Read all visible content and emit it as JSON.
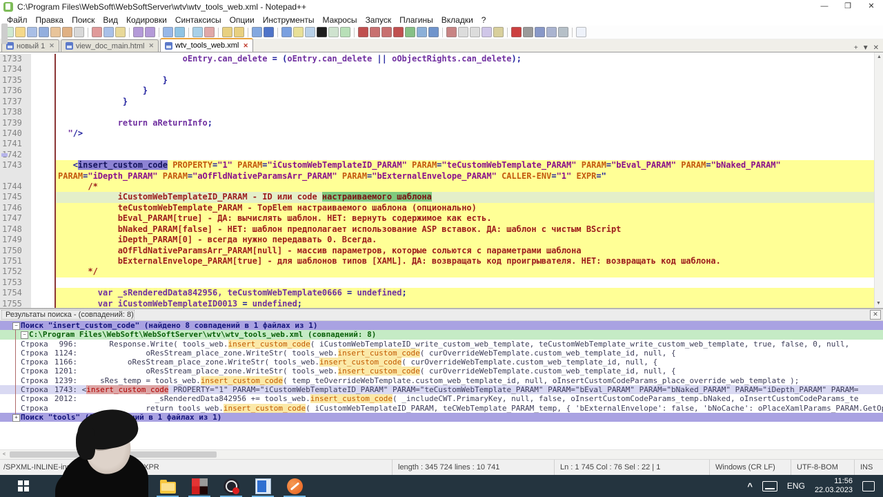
{
  "window": {
    "title": "C:\\Program Files\\WebSoft\\WebSoftServer\\wtv\\wtv_tools_web.xml - Notepad++",
    "controls": {
      "minimize": "—",
      "restore": "❐",
      "close": "✕"
    }
  },
  "menu": {
    "items": [
      "Файл",
      "Правка",
      "Поиск",
      "Вид",
      "Кодировки",
      "Синтаксисы",
      "Опции",
      "Инструменты",
      "Макросы",
      "Запуск",
      "Плагины",
      "Вкладки",
      "?"
    ]
  },
  "toolbar": {
    "icons": [
      {
        "n": "new-file",
        "c": "#cfe8cf"
      },
      {
        "n": "open-file",
        "c": "#f4d88a"
      },
      {
        "n": "save",
        "c": "#a9bfe6"
      },
      {
        "n": "save-all",
        "c": "#93aede"
      },
      {
        "n": "close",
        "c": "#e8c49a"
      },
      {
        "n": "close-all",
        "c": "#e0b184"
      },
      {
        "n": "print",
        "c": "#d8d8d8"
      },
      {
        "n": "sep"
      },
      {
        "n": "cut",
        "c": "#e09a9a"
      },
      {
        "n": "copy",
        "c": "#a8c0e8"
      },
      {
        "n": "paste",
        "c": "#e8d898"
      },
      {
        "n": "sep"
      },
      {
        "n": "undo",
        "c": "#b49ad8"
      },
      {
        "n": "redo",
        "c": "#b49ad8"
      },
      {
        "n": "sep"
      },
      {
        "n": "find",
        "c": "#98b8e8"
      },
      {
        "n": "replace",
        "c": "#8fc4e4"
      },
      {
        "n": "sep"
      },
      {
        "n": "zoom-in",
        "c": "#a8d0e8"
      },
      {
        "n": "zoom-out",
        "c": "#e0a8a8"
      },
      {
        "n": "sep"
      },
      {
        "n": "sync-vertical",
        "c": "#e8d080"
      },
      {
        "n": "sync-horizontal",
        "c": "#e8d080"
      },
      {
        "n": "sep"
      },
      {
        "n": "word-wrap",
        "c": "#84a8e0"
      },
      {
        "n": "show-symbols",
        "c": "#4f74c9"
      },
      {
        "n": "sep"
      },
      {
        "n": "indent-guide",
        "c": "#7aa0e0"
      },
      {
        "n": "doc-switcher",
        "c": "#e8e098"
      },
      {
        "n": "doc-map",
        "c": "#b8d0e8"
      },
      {
        "n": "console",
        "c": "#1d1d1d"
      },
      {
        "n": "view-source",
        "c": "#cfe3cf"
      },
      {
        "n": "validate",
        "c": "#b8e0b8"
      },
      {
        "n": "sep"
      },
      {
        "n": "nav-first",
        "c": "#c05050"
      },
      {
        "n": "nav-prev",
        "c": "#c87070"
      },
      {
        "n": "nav-next",
        "c": "#c87070"
      },
      {
        "n": "nav-last",
        "c": "#c05050"
      },
      {
        "n": "macro-save",
        "c": "#86c086"
      },
      {
        "n": "macro-play",
        "c": "#8cb0d8"
      },
      {
        "n": "macro-run",
        "c": "#6f94cc"
      },
      {
        "n": "sep"
      },
      {
        "n": "strike",
        "c": "#c88484"
      },
      {
        "n": "doc1",
        "c": "#dcdcdc"
      },
      {
        "n": "doc2",
        "c": "#dcdcdc"
      },
      {
        "n": "preview",
        "c": "#cfc6e8"
      },
      {
        "n": "eye",
        "c": "#d8cf9c"
      },
      {
        "n": "sep"
      },
      {
        "n": "record",
        "c": "#cc4040"
      },
      {
        "n": "stop",
        "c": "#9a9a9a"
      },
      {
        "n": "step-over",
        "c": "#8898c8"
      },
      {
        "n": "func-list",
        "c": "#aab4d0"
      },
      {
        "n": "tiles",
        "c": "#b6c0c8"
      },
      {
        "n": "sep"
      },
      {
        "n": "help",
        "c": "#eef2fa"
      }
    ]
  },
  "tabs": {
    "items": [
      {
        "label": "новый 1",
        "active": false
      },
      {
        "label": "view_doc_main.html",
        "active": false
      },
      {
        "label": "wtv_tools_web.xml",
        "active": true
      }
    ],
    "controls": {
      "new_tab": "+",
      "list": "▼",
      "close": "✕"
    }
  },
  "editor": {
    "lines": [
      {
        "num": "1733",
        "bg": "n",
        "segs": [
          [
            "w",
            "                         "
          ],
          [
            "k",
            "oEntry.can_delete "
          ],
          [
            "o",
            "= ("
          ],
          [
            "k",
            "oEntry.can_delete "
          ],
          [
            "o",
            "|| "
          ],
          [
            "k",
            "oObjectRights.can_delete"
          ],
          [
            "o",
            ");"
          ]
        ]
      },
      {
        "num": "1734",
        "bg": "n",
        "segs": []
      },
      {
        "num": "1735",
        "bg": "n",
        "segs": [
          [
            "w",
            "                     "
          ],
          [
            "o",
            "}"
          ]
        ]
      },
      {
        "num": "1736",
        "bg": "n",
        "segs": [
          [
            "w",
            "                 "
          ],
          [
            "o",
            "}"
          ]
        ]
      },
      {
        "num": "1737",
        "bg": "n",
        "segs": [
          [
            "w",
            "             "
          ],
          [
            "o",
            "}"
          ]
        ]
      },
      {
        "num": "1738",
        "bg": "n",
        "segs": []
      },
      {
        "num": "1739",
        "bg": "n",
        "segs": [
          [
            "w",
            "            "
          ],
          [
            "k",
            "return aReturnInfo"
          ],
          [
            "o",
            ";"
          ]
        ]
      },
      {
        "num": "1740",
        "bg": "n",
        "segs": [
          [
            "w",
            "  "
          ],
          [
            "k",
            "\""
          ],
          [
            "o",
            "/>"
          ]
        ]
      },
      {
        "num": "1741",
        "bg": "n",
        "segs": []
      },
      {
        "num": "1742",
        "bg": "n",
        "segs": []
      },
      {
        "num": "1743",
        "bg": "y",
        "segs": [
          [
            "w",
            "   "
          ],
          [
            "o",
            "<"
          ],
          [
            "h",
            "insert_custom_code"
          ],
          [
            "w",
            " "
          ],
          [
            "a",
            "PROPERTY"
          ],
          [
            "o",
            "="
          ],
          [
            "v",
            "\"1\""
          ],
          [
            "w",
            " "
          ],
          [
            "a",
            "PARAM"
          ],
          [
            "o",
            "="
          ],
          [
            "v",
            "\"iCustomWebTemplateID_PARAM\""
          ],
          [
            "w",
            " "
          ],
          [
            "a",
            "PARAM"
          ],
          [
            "o",
            "="
          ],
          [
            "v",
            "\"teCustomWebTemplate_PARAM\""
          ],
          [
            "w",
            " "
          ],
          [
            "a",
            "PARAM"
          ],
          [
            "o",
            "="
          ],
          [
            "v",
            "\"bEval_PARAM\""
          ],
          [
            "w",
            " "
          ],
          [
            "a",
            "PARAM"
          ],
          [
            "o",
            "="
          ],
          [
            "v",
            "\"bNaked_PARAM\""
          ]
        ]
      },
      {
        "num": "",
        "bg": "y",
        "segs": [
          [
            "a",
            "PARAM"
          ],
          [
            "o",
            "="
          ],
          [
            "v",
            "\"iDepth_PARAM\""
          ],
          [
            "w",
            " "
          ],
          [
            "a",
            "PARAM"
          ],
          [
            "o",
            "="
          ],
          [
            "v",
            "\"aOfFldNativeParamsArr_PARAM\""
          ],
          [
            "w",
            " "
          ],
          [
            "a",
            "PARAM"
          ],
          [
            "o",
            "="
          ],
          [
            "v",
            "\"bExternalEnvelope_PARAM\""
          ],
          [
            "w",
            " "
          ],
          [
            "a",
            "CALLER-ENV"
          ],
          [
            "o",
            "="
          ],
          [
            "v",
            "\"1\""
          ],
          [
            "w",
            " "
          ],
          [
            "a",
            "EXPR"
          ],
          [
            "o",
            "=\""
          ]
        ]
      },
      {
        "num": "1744",
        "bg": "y",
        "segs": [
          [
            "w",
            "      "
          ],
          [
            "c",
            "/*"
          ]
        ]
      },
      {
        "num": "1745",
        "bg": "g",
        "segs": [
          [
            "w",
            "            "
          ],
          [
            "c",
            "iCustomWebTemplateID_PARAM - ID или code "
          ],
          [
            "m",
            "настраиваемого шаблона"
          ]
        ]
      },
      {
        "num": "1746",
        "bg": "y",
        "segs": [
          [
            "w",
            "            "
          ],
          [
            "c",
            "teCustomWebTemplate_PARAM - TopElem настраиваемого шаблона (опционально)"
          ]
        ]
      },
      {
        "num": "1747",
        "bg": "y",
        "segs": [
          [
            "w",
            "            "
          ],
          [
            "c",
            "bEval_PARAM[true] - ДА: вычислять шаблон. НЕТ: вернуть содержимое как есть."
          ]
        ]
      },
      {
        "num": "1748",
        "bg": "y",
        "segs": [
          [
            "w",
            "            "
          ],
          [
            "c",
            "bNaked_PARAM[false] - НЕТ: шаблон предполагает использование ASP вставок. ДА: шаблон с чистым BScript"
          ]
        ]
      },
      {
        "num": "1749",
        "bg": "y",
        "segs": [
          [
            "w",
            "            "
          ],
          [
            "c",
            "iDepth_PARAM[0] - всегда нужно передавать 0. Всегда."
          ]
        ]
      },
      {
        "num": "1750",
        "bg": "y",
        "segs": [
          [
            "w",
            "            "
          ],
          [
            "c",
            "aOfFldNativeParamsArr_PARAM[null] - массив параметров, которые сольются с параметрами шаблона"
          ]
        ]
      },
      {
        "num": "1751",
        "bg": "y",
        "segs": [
          [
            "w",
            "            "
          ],
          [
            "c",
            "bExternalEnvelope_PARAM[true] - для шаблонов типов [XAML]. ДА: возвращать код проигрывателя. НЕТ: возвращать код шаблона."
          ]
        ]
      },
      {
        "num": "1752",
        "bg": "y",
        "segs": [
          [
            "w",
            "      "
          ],
          [
            "c",
            "*/"
          ]
        ]
      },
      {
        "num": "1753",
        "bg": "n",
        "segs": []
      },
      {
        "num": "1754",
        "bg": "y",
        "segs": [
          [
            "w",
            "        "
          ],
          [
            "k",
            "var _sRenderedData842956, teCustomWebTemplate0666 "
          ],
          [
            "o",
            "= "
          ],
          [
            "k",
            "undefined"
          ],
          [
            "o",
            ";"
          ]
        ]
      },
      {
        "num": "1755",
        "bg": "y",
        "segs": [
          [
            "w",
            "        "
          ],
          [
            "k",
            "var iCustomWebTemplateID0013 "
          ],
          [
            "o",
            "= "
          ],
          [
            "k",
            "undefined"
          ],
          [
            "o",
            ";"
          ]
        ]
      }
    ]
  },
  "results_panel": {
    "title": "Результаты поиска - (совпадений: 8)",
    "close_glyph": "✕",
    "search_header": "Поиск \"insert_custom_code\" (найдено 8 совпадений в 1 файлах из 1)",
    "file_header": "C:\\Program Files\\WebSoft\\WebSoftServer\\wtv\\wtv_tools_web.xml (совпадений: 8)",
    "row_label": "Строка",
    "rows": [
      {
        "num": "996:",
        "indent": "       ",
        "before": "Response.Write( tools_web.",
        "match": "insert_custom_code",
        "after": "( iCustomWebTemplateID_write_custom_web_template, teCustomWebTemplate_write_custom_web_template, true, false, 0, null,",
        "cur": false
      },
      {
        "num": "1124:",
        "indent": "               ",
        "before": "oResStream_place_zone.WriteStr( tools_web.",
        "match": "insert_custom_code",
        "after": "( curOverrideWebTemplate.custom_web_template_id, null, {",
        "cur": false
      },
      {
        "num": "1166:",
        "indent": "           ",
        "before": "oResStream_place_zone.WriteStr( tools_web.",
        "match": "insert_custom_code",
        "after": "( curOverrideWebTemplate.custom_web_template_id, null, {",
        "cur": false
      },
      {
        "num": "1201:",
        "indent": "               ",
        "before": "oResStream_place_zone.WriteStr( tools_web.",
        "match": "insert_custom_code",
        "after": "( curOverrideWebTemplate.custom_web_template_id, null, {",
        "cur": false
      },
      {
        "num": "1239:",
        "indent": "     ",
        "before": "sRes_temp = tools_web.",
        "match": "insert_custom_code",
        "after": "( temp_teOverrideWebTemplate.custom_web_template_id, null, oInsertCustomCodeParams_place_override_web_template );",
        "cur": false
      },
      {
        "num": "1743:",
        "indent": " ",
        "before": "<",
        "match": "insert_custom_code",
        "after": " PROPERTY=\"1\" PARAM=\"iCustomWebTemplateID_PARAM\" PARAM=\"teCustomWebTemplate_PARAM\" PARAM=\"bEval_PARAM\" PARAM=\"bNaked_PARAM\" PARAM=\"iDepth_PARAM\" PARAM=",
        "cur": true
      },
      {
        "num": "2012:",
        "indent": "                 ",
        "before": "_sRenderedData842956 += tools_web.",
        "match": "insert_custom_code",
        "after": "( _includeCWT.PrimaryKey, null, false, oInsertCustomCodeParams_temp.bNaked, oInsertCustomCodeParams_te",
        "cur": false
      },
      {
        "num": "",
        "indent": "               ",
        "before": "return tools_web.",
        "match": "insert_custom_code",
        "after": "( iCustomWebTemplateID_PARAM, teCWebTemplate_PARAM_temp, { 'bExternalEnvelope': false, 'bNoCache': oPlaceXamlParams_PARAM.GetOptPro",
        "cur": false
      }
    ],
    "footer_search": "Поиск \"tools\" (8 совпадений в 1 файлах из 1)",
    "hscroll_left_arrow": "<"
  },
  "statusbar": {
    "doc_path": "/SPXML-INLINE-insert_custom_code/@EXPR",
    "length_lines": "length : 345 724     lines : 10 741",
    "cursor": "Ln : 1 745     Col : 76     Sel : 22 | 1",
    "eol": "Windows (CR LF)",
    "encoding": "UTF-8-BOM",
    "mode": "INS"
  },
  "taskbar": {
    "apps": [
      {
        "n": "chrome",
        "cls": "g-chrome"
      },
      {
        "n": "file-explorer",
        "cls": "g-folder"
      },
      {
        "n": "red-grid-app",
        "cls": "g-redgrid"
      },
      {
        "n": "obs-studio",
        "cls": "g-obs"
      },
      {
        "n": "blue-window-app",
        "cls": "g-bluewin"
      },
      {
        "n": "orange-ball-app",
        "cls": "g-orange"
      }
    ],
    "tray": {
      "chevron": "^",
      "lang": "ENG",
      "time": "11:56",
      "date": "22.03.2023"
    }
  }
}
